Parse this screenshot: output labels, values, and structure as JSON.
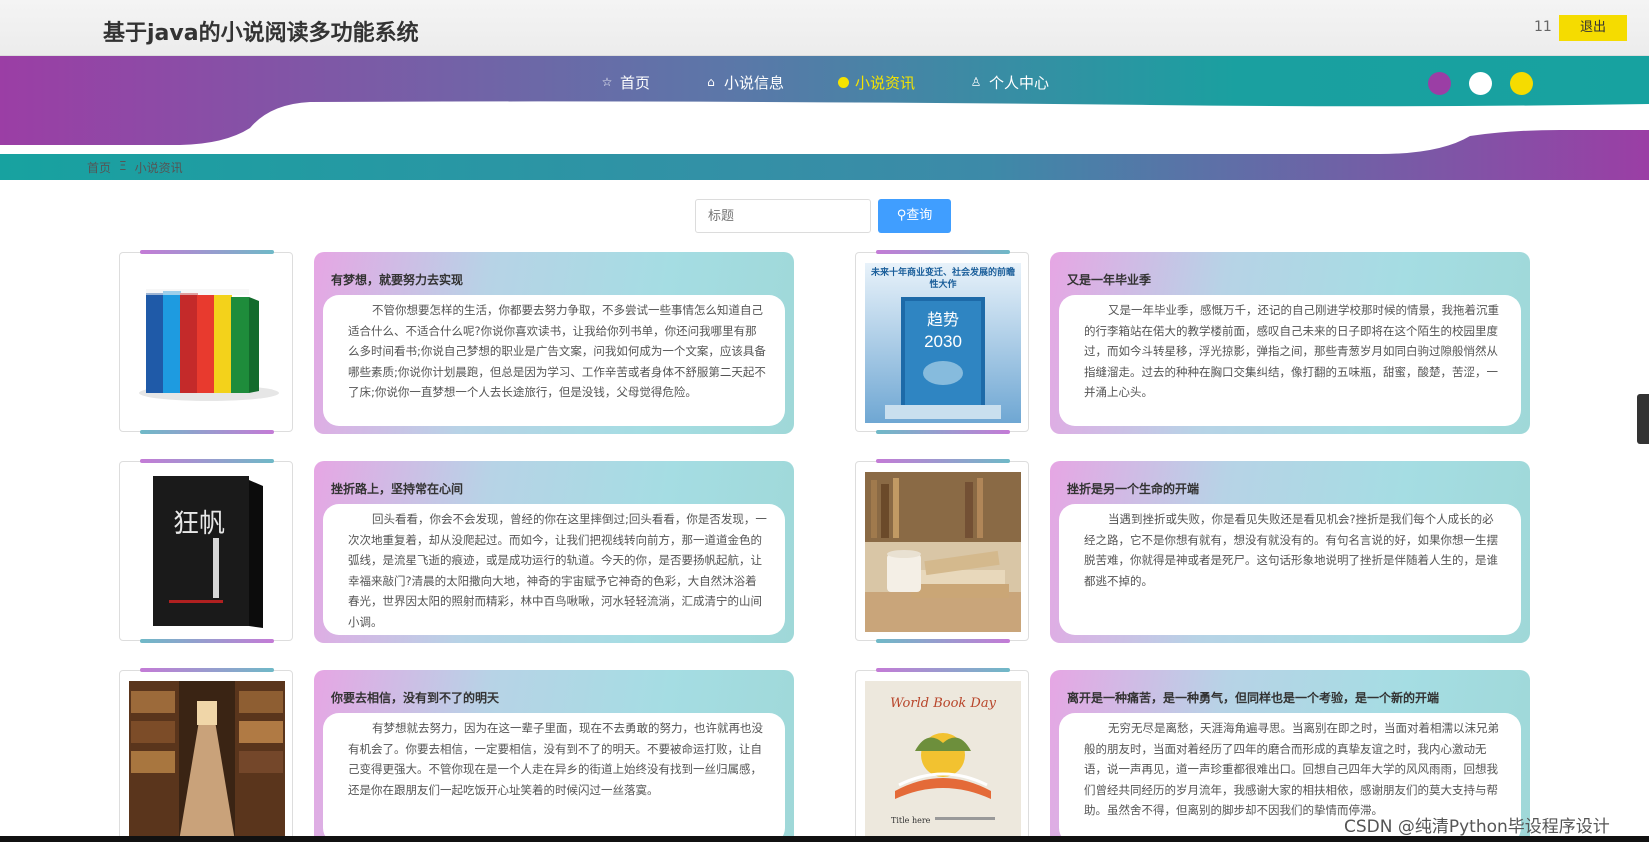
{
  "header": {
    "title": "基于java的小说阅读多功能系统",
    "user": "11",
    "logout_label": "退出"
  },
  "nav": {
    "items": [
      {
        "label": "首页",
        "icon": "home-icon"
      },
      {
        "label": "小说信息",
        "icon": "bag-icon"
      },
      {
        "label": "小说资讯",
        "icon": "dot-icon",
        "active": true
      },
      {
        "label": "个人中心",
        "icon": "user-icon"
      }
    ],
    "theme_colors": [
      "#9b3ea5",
      "#ffffff",
      "#f5dc00"
    ]
  },
  "breadcrumb": {
    "home": "首页",
    "separator": "Ξ",
    "current": "小说资讯"
  },
  "search": {
    "placeholder": "标题",
    "button_label": "查询"
  },
  "colors": {
    "nav_purple": "#9b3ea5",
    "nav_teal": "#1aa0a0",
    "search_button": "#409eff",
    "accent_yellow": "#f5dc00"
  },
  "articles": [
    {
      "title": "有梦想，就要努力去实现",
      "image": "colorful-books",
      "body": "不管你想要怎样的生活，你都要去努力争取，不多尝试一些事情怎么知道自己适合什么、不适合什么呢?你说你喜欢读书，让我给你列书单，你还问我哪里有那么多时间看书;你说自己梦想的职业是广告文案，问我如何成为一个文案，应该具备哪些素质;你说你计划晨跑，但总是因为学习、工作辛苦或者身体不舒服第二天起不了床;你说你一直梦想一个人去长途旅行，但是没钱，父母觉得危险。"
    },
    {
      "title": "又是一年毕业季",
      "image": "trend-2030-book",
      "body": "又是一年毕业季，感慨万千，还记的自己刚进学校那时候的情景，我拖着沉重的行李箱站在偌大的教学楼前面，感叹自己未来的日子即将在这个陌生的校园里度过，而如今斗转星移，浮光掠影，弹指之间，那些青葱岁月如同白驹过隙般悄然从指缝溜走。过去的种种在胸口交集纠结，像打翻的五味瓶，甜蜜，酸楚，苦涩，一并涌上心头。"
    },
    {
      "title": "挫折路上，坚持常在心间",
      "image": "black-novel-cover",
      "body": "回头看看，你会不会发现，曾经的你在这里摔倒过;回头看看，你是否发现，一次次地重复着，却从没爬起过。而如今，让我们把视线转向前方，那一道道金色的弧线，是流星飞逝的痕迹，或是成功运行的轨道。今天的你，是否要扬帆起航，让幸福来敲门?清晨的太阳撒向大地，神奇的宇宙赋予它神奇的色彩，大自然沐浴着春光，世界因太阳的照射而精彩，林中百鸟啾啾，河水轻轻流淌，汇成清宁的山间小调。"
    },
    {
      "title": "挫折是另一个生命的开端",
      "image": "cup-and-books",
      "body": "当遇到挫折或失败，你是看见失败还是看见机会?挫折是我们每个人成长的必经之路，它不是你想有就有，想没有就没有的。有句名言说的好，如果你想一生摆脱苦难，你就得是神或者是死尸。这句话形象地说明了挫折是伴随着人生的，是谁都逃不掉的。"
    },
    {
      "title": "你要去相信，没有到不了的明天",
      "image": "library-shelves",
      "body": "有梦想就去努力，因为在这一辈子里面，现在不去勇敢的努力，也许就再也没有机会了。你要去相信，一定要相信，没有到不了的明天。不要被命运打败，让自己变得更强大。不管你现在是一个人走在异乡的街道上始终没有找到一丝归属感，还是你在跟朋友们一起吃饭开心址笑着的时候闪过一丝落寞。"
    },
    {
      "title": "离开是一种痛苦，是一种勇气，但同样也是一个考验，是一个新的开端",
      "image": "world-book-day-poster",
      "body": "无穷无尽是离愁，天涯海角遍寻思。当离别在即之时，当面对着相濡以沫兄弟般的朋友时，当面对着经历了四年的磨合而形成的真挚友谊之时，我内心激动无语，说一声再见，道一声珍重都很难出口。回想自己四年大学的风风雨雨，回想我们曾经共同经历的岁月流年，我感谢大家的相扶相依，感谢朋友们的莫大支持与帮助。虽然舍不得，但离别的脚步却不因我们的挚情而停滞。"
    }
  ],
  "image_text": {
    "trend_header": "未来十年商业变迁、社会发展的前瞻性大作",
    "trend_title": "趋势",
    "trend_year": "2030",
    "novel_title": "狂帆",
    "wbd_title": "World Book Day",
    "wbd_sub": "Title here"
  },
  "watermark": "CSDN @纯清Python毕设程序设计"
}
